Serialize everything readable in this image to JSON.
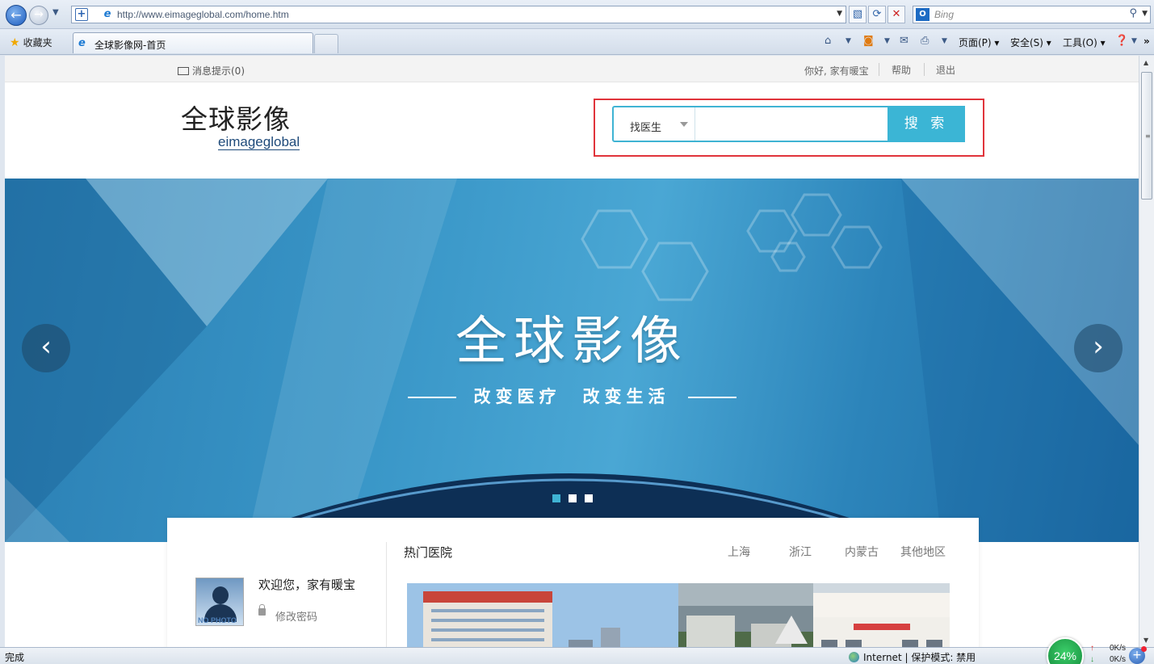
{
  "browser": {
    "url": "http://www.eimageglobal.com/home.htm",
    "search_placeholder": "Bing",
    "favorites_label": "收藏夹",
    "tab_title": "全球影像网-首页",
    "cmd_page": "页面(P)",
    "cmd_safety": "安全(S)",
    "cmd_tools": "工具(O)",
    "status_text": "完成",
    "zone_text": "Internet | 保护模式: 禁用",
    "speed_percent": "24%",
    "upload_rate": "0K/s",
    "download_rate": "0K/s"
  },
  "topbar": {
    "message": "消息提示(0)",
    "greeting": "你好, 家有暖宝",
    "help": "帮助",
    "logout": "退出"
  },
  "header": {
    "logo_cn": "全球影像",
    "logo_en": "eimageglobal",
    "search_category": "找医生",
    "search_value": "",
    "search_button": "搜 索"
  },
  "banner": {
    "title": "全球影像",
    "subtitle": "改变医疗　改变生活",
    "prev": "‹",
    "next": "›",
    "active_slide": 1,
    "slide_count": 3
  },
  "user": {
    "no_photo": "NO PHOTO",
    "welcome": "欢迎您，家有暖宝",
    "change_password": "修改密码"
  },
  "hospitals": {
    "title": "热门医院",
    "regions": [
      "上海",
      "浙江",
      "内蒙古",
      "其他地区"
    ]
  },
  "colors": {
    "accent": "#3bb5d5",
    "highlight_box": "#e0343b",
    "banner_blue": "#2a7eb3"
  }
}
